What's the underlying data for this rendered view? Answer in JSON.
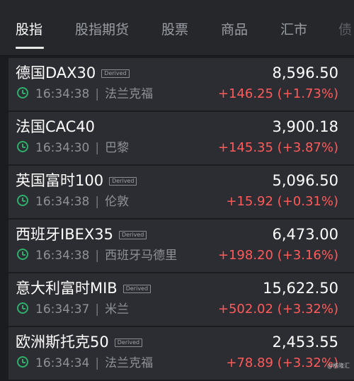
{
  "tabs": [
    {
      "label": "股指",
      "active": true
    },
    {
      "label": "股指期货"
    },
    {
      "label": "股票"
    },
    {
      "label": "商品"
    },
    {
      "label": "汇市"
    }
  ],
  "tab_edge_fragment": "债",
  "items": [
    {
      "name": "德国DAX30",
      "badge": "Derived",
      "time": "16:34:38",
      "location": "法兰克福",
      "price": "8,596.50",
      "change": "+146.25 (+1.73%)"
    },
    {
      "name": "法国CAC40",
      "badge": "",
      "time": "16:34:30",
      "location": "巴黎",
      "price": "3,900.18",
      "change": "+145.35 (+3.87%)"
    },
    {
      "name": "英国富时100",
      "badge": "Derived",
      "time": "16:34:38",
      "location": "伦敦",
      "price": "5,096.50",
      "change": "+15.92 (+0.31%)"
    },
    {
      "name": "西班牙IBEX35",
      "badge": "Derived",
      "time": "16:34:38",
      "location": "西班牙马德里",
      "price": "6,473.00",
      "change": "+198.20 (+3.16%)"
    },
    {
      "name": "意大利富时MIB",
      "badge": "Derived",
      "time": "16:34:37",
      "location": "米兰",
      "price": "15,622.50",
      "change": "+502.02 (+3.32%)"
    },
    {
      "name": "欧洲斯托克50",
      "badge": "Derived",
      "time": "16:34:34",
      "location": "法兰克福",
      "price": "2,453.55",
      "change": "+78.89 (+3.32%)"
    }
  ],
  "separator": "|",
  "watermark": "@格隆汇",
  "colors": {
    "up": "#ff5a5a",
    "clock": "#2fae6a",
    "background": "#1b1c20",
    "row": "#2c2d32"
  }
}
